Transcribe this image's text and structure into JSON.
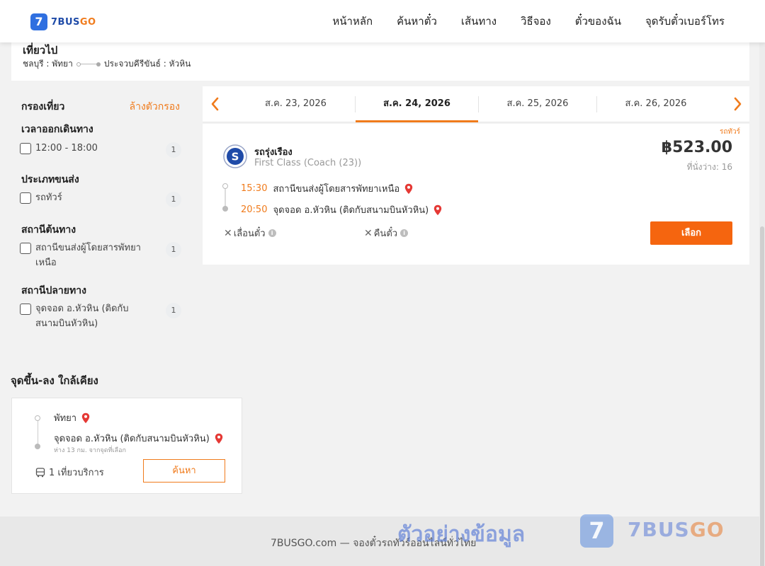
{
  "brand": {
    "logo_mark": "7",
    "name_part1": "7BUS",
    "name_part2": "GO"
  },
  "nav": [
    {
      "label": "หน้าหลัก"
    },
    {
      "label": "ค้นหาตั๋ว"
    },
    {
      "label": "เส้นทาง"
    },
    {
      "label": "วิธีจอง"
    },
    {
      "label": "ตั๋วของฉัน"
    },
    {
      "label": "จุดรับตั๋วเบอร์โทร"
    }
  ],
  "trip": {
    "title": "เที่ยวไป",
    "origin": "ชลบุรี : พัทยา",
    "destination": "ประจวบคีรีขันธ์ : หัวหิน"
  },
  "filters": {
    "title": "กรองเที่ยว",
    "clear_label": "ล้างตัวกรอง",
    "groups": [
      {
        "title": "เวลาออกเดินทาง",
        "options": [
          {
            "label": "12:00 - 18:00",
            "count": "1",
            "checked": false
          }
        ]
      },
      {
        "title": "ประเภทขนส่ง",
        "options": [
          {
            "label": "รถทัวร์",
            "count": "1",
            "checked": false
          }
        ]
      },
      {
        "title": "สถานีต้นทาง",
        "options": [
          {
            "label": "สถานีขนส่งผู้โดยสารพัทยาเหนือ",
            "count": "1",
            "checked": false
          }
        ]
      },
      {
        "title": "สถานีปลายทาง",
        "options": [
          {
            "label": "จุดจอด อ.หัวหิน (ติดกับสนามบินหัวหิน)",
            "count": "1",
            "checked": false
          }
        ]
      }
    ]
  },
  "dates": [
    {
      "label": "ส.ค. 23, 2026",
      "active": false
    },
    {
      "label": "ส.ค. 24, 2026",
      "active": true
    },
    {
      "label": "ส.ค. 25, 2026",
      "active": false
    },
    {
      "label": "ส.ค. 26, 2026",
      "active": false
    }
  ],
  "result": {
    "tag": "รถทัวร์",
    "operator": "รถรุ่งเรือง",
    "class": "First Class (Coach (23))",
    "price": "฿523.00",
    "seats": "ที่นั่งว่าง: 16",
    "depart_time": "15:30",
    "depart_station": "สถานีขนส่งผู้โดยสารพัทยาเหนือ",
    "arrive_time": "20:50",
    "arrive_station": "จุดจอด อ.หัวหิน (ติดกับสนามบินหัวหิน)",
    "reschedule_label": "เลื่อนตั๋ว",
    "refund_label": "คืนตั๋ว",
    "select_label": "เลือก"
  },
  "nearby": {
    "title": "จุดขึ้น-ลง ใกล้เคียง",
    "from": "พัทยา",
    "to": "จุดจอด อ.หัวหิน (ติดกับสนามบินหัวหิน)",
    "distance": "ห่าง 13 กม. จากจุดที่เลือก",
    "trips": "1 เที่ยวบริการ",
    "search_label": "ค้นหา"
  },
  "footer": {
    "text": "7BUSGO.com — จองตั๋วรถทัวร์ออนไลน์ทั่วไทย",
    "watermark": "ตัวอย่างข้อมูล",
    "wm_mark": "7",
    "wm_brand1": "7BUS",
    "wm_brand2": "GO"
  },
  "colors": {
    "accent": "#f07b1c",
    "button": "#f5650f",
    "brand_blue": "#2f6fe0",
    "pin_red": "#e53935"
  },
  "icons": [
    "chevron-left-icon",
    "chevron-right-icon",
    "map-pin-icon",
    "close-icon",
    "info-icon",
    "bus-icon",
    "operator-logo-icon"
  ]
}
